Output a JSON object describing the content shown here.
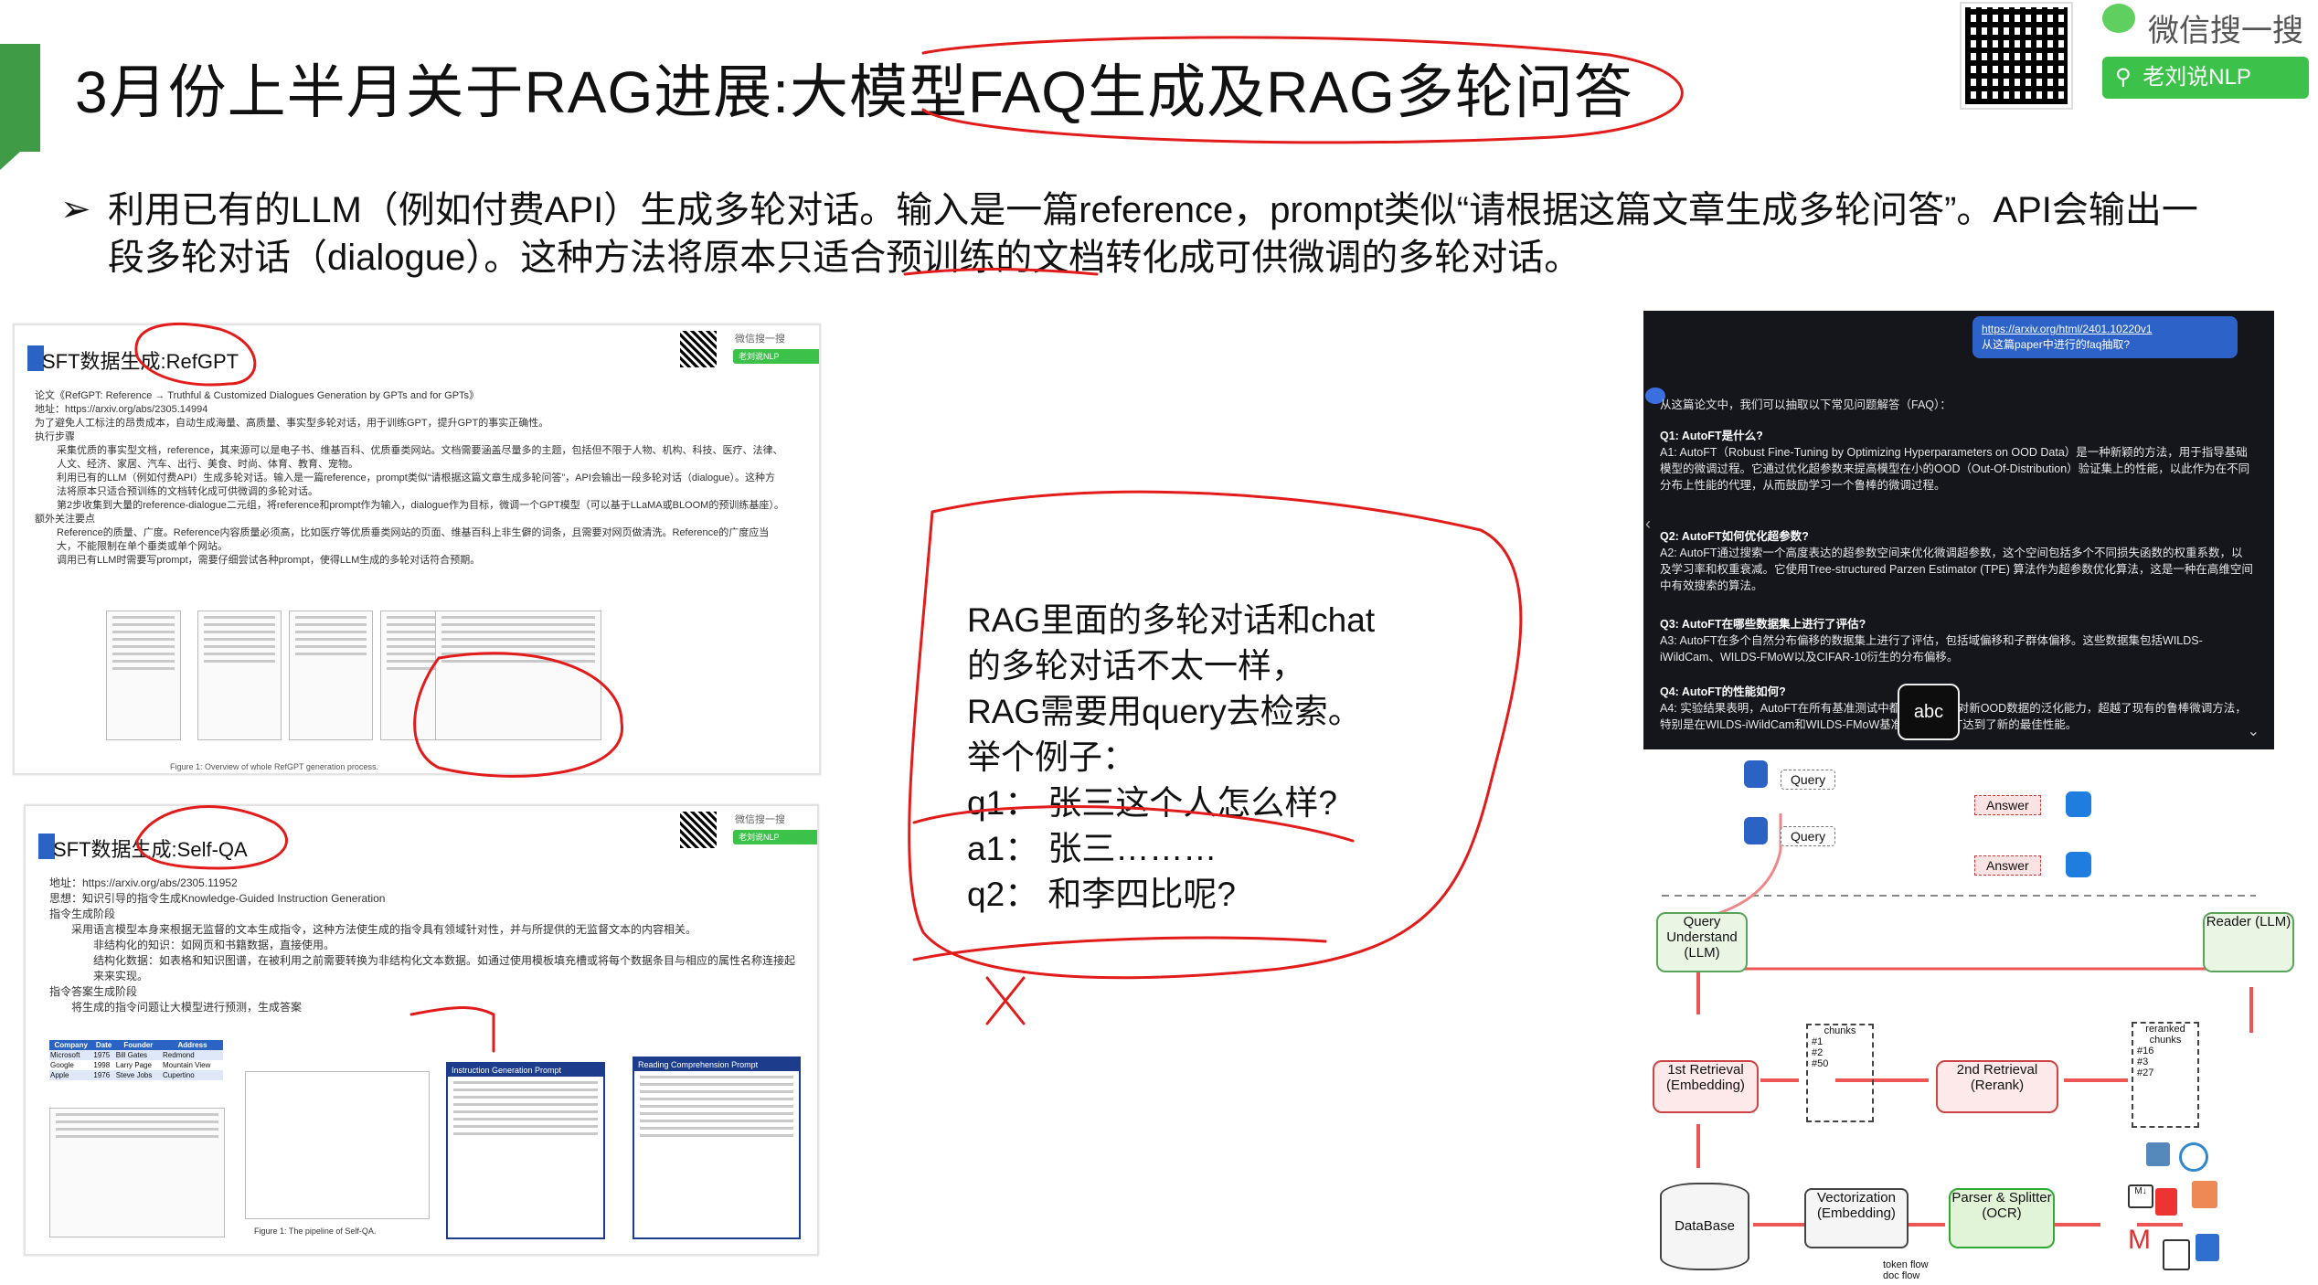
{
  "header": {
    "title": "3月份上半月关于RAG进展:大模型FAQ生成及RAG多轮问答",
    "wechat_label": "微信搜一搜",
    "search_label": "老刘说NLP"
  },
  "bullet": {
    "marker": "➢",
    "text": "利用已有的LLM（例如付费API）生成多轮对话。输入是一篇reference，prompt类似“请根据这篇文章生成多轮问答”。API会输出一段多轮对话（dialogue）。这种方法将原本只适合预训练的文档转化成可供微调的多轮对话。"
  },
  "slide1": {
    "title": "SFT数据生成:RefGPT",
    "wechat": "微信搜一搜",
    "search": "老刘说NLP",
    "lines": [
      "论文《RefGPT: Reference → Truthful & Customized Dialogues Generation by GPTs and for GPTs》",
      "地址：https://arxiv.org/abs/2305.14994",
      "为了避免人工标注的昂贵成本，自动生成海量、高质量、事实型多轮对话，用于训练GPT，提升GPT的事实正确性。",
      "执行步骤",
      "采集优质的事实型文档，reference，其来源可以是电子书、维基百科、优质垂类网站。文档需要涵盖尽量多的主题，包括但不限于人物、机构、科技、医疗、法律、人文、经济、家居、汽车、出行、美食、时尚、体育、教育、宠物。",
      "利用已有的LLM（例如付费API）生成多轮对话。输入是一篇reference，prompt类似“请根据这篇文章生成多轮问答”，API会输出一段多轮对话（dialogue）。这种方法将原本只适合预训练的文档转化成可供微调的多轮对话。",
      "第2步收集到大量的reference-dialogue二元组，将reference和prompt作为输入，dialogue作为目标，微调一个GPT模型（可以基于LLaMA或BLOOM的预训练基座）。",
      "额外关注要点",
      "Reference的质量、广度。Reference内容质量必须高，比如医疗等优质垂类网站的页面、维基百科上非生僻的词条，且需要对网页做清洗。Reference的广度应当大，不能限制在单个垂类或单个网站。",
      "调用已有LLM时需要写prompt，需要仔细尝试各种prompt，使得LLM生成的多轮对话符合预期。"
    ],
    "caption": "Figure 1: Overview of whole RefGPT generation process."
  },
  "slide2": {
    "title": "SFT数据生成:Self-QA",
    "wechat": "微信搜一搜",
    "search": "老刘说NLP",
    "lines": [
      "地址：https://arxiv.org/abs/2305.11952",
      "思想：知识引导的指令生成Knowledge-Guided Instruction Generation",
      "指令生成阶段",
      "采用语言模型本身来根据无监督的文本生成指令，这种方法使生成的指令具有领域针对性，并与所提供的无监督文本的内容相关。",
      "非结构化的知识：如网页和书籍数据，直接使用。",
      "结构化数据：如表格和知识图谱，在被利用之前需要转换为非结构化文本数据。如通过使用模板填充槽或将每个数据条目与相应的属性名称连接起来来实现。",
      "指令答案生成阶段",
      "将生成的指令问题让大模型进行预测，生成答案"
    ],
    "table_headers": [
      "Company",
      "Date",
      "Founder",
      "Address"
    ],
    "table_rows": [
      [
        "Microsoft",
        "1975",
        "Bill Gates",
        "Redmond"
      ],
      [
        "Google",
        "1998",
        "Larry Page",
        "Mountain View"
      ],
      [
        "Apple",
        "1976",
        "Steve Jobs",
        "Cupertino"
      ]
    ],
    "caption": "Figure 1: The pipeline of Self-QA.",
    "box1_title": "Instruction Generation Prompt",
    "box2_title": "Reading Comprehension Prompt"
  },
  "note": {
    "lines": [
      "RAG里面的多轮对话和chat",
      "的多轮对话不太一样，",
      "RAG需要用query去检索。",
      "举个例子：",
      "q1： 张三这个人怎么样?",
      "a1： 张三………",
      "q2： 和李四比呢?"
    ]
  },
  "chat_panel": {
    "link": "https://arxiv.org/html/2401.10220v1",
    "request": "从这篇paper中进行的faq抽取?",
    "intro": "从这篇论文中，我们可以抽取以下常见问题解答（FAQ）：",
    "qa": [
      {
        "q": "Q1: AutoFT是什么?",
        "a": "A1: AutoFT（Robust Fine-Tuning by Optimizing Hyperparameters on OOD Data）是一种新颖的方法，用于指导基础模型的微调过程。它通过优化超参数来提高模型在小的OOD（Out-Of-Distribution）验证集上的性能，以此作为在不同分布上性能的代理，从而鼓励学习一个鲁棒的微调过程。"
      },
      {
        "q": "Q2: AutoFT如何优化超参数?",
        "a": "A2: AutoFT通过搜索一个高度表达的超参数空间来优化微调超参数，这个空间包括多个不同损失函数的权重系数，以及学习率和权重衰减。它使用Tree-structured Parzen Estimator (TPE) 算法作为超参数优化算法，这是一种在高维空间中有效搜索的算法。"
      },
      {
        "q": "Q3: AutoFT在哪些数据集上进行了评估?",
        "a": "A3: AutoFT在多个自然分布偏移的数据集上进行了评估，包括域偏移和子群体偏移。这些数据集包括WILDS-iWildCam、WILDS-FMoW以及CIFAR-10衍生的分布偏移。"
      },
      {
        "q": "Q4: AutoFT的性能如何?",
        "a": "A4: 实验结果表明，AutoFT在所有基准测试中都显著提高了对新OOD数据的泛化能力，超越了现有的鲁棒微调方法，特别是在WILDS-iWildCam和WILDS-FMoW基准上，AutoFT达到了新的最佳性能。"
      }
    ],
    "badge": "abc"
  },
  "diagram": {
    "query": "Query",
    "answer": "Answer",
    "query_understand": "Query Understand (LLM)",
    "reader": "Reader (LLM)",
    "retrieval1": "1st Retrieval (Embedding)",
    "retrieval2": "2nd Retrieval (Rerank)",
    "chunks": "chunks",
    "reranked": "reranked chunks",
    "chunk_labels": [
      "#1",
      "#2",
      "#50"
    ],
    "reranked_labels": [
      "#16",
      "#3",
      "#27"
    ],
    "database": "DataBase",
    "vectorization": "Vectorization (Embedding)",
    "parser": "Parser & Splitter (OCR)",
    "legend_token": "token flow",
    "legend_doc": "doc flow"
  },
  "colors": {
    "accent_green": "#3f9b45",
    "ink_red": "#e21b1b",
    "panel_dark": "#14161c",
    "link_blue": "#2d62c9"
  }
}
